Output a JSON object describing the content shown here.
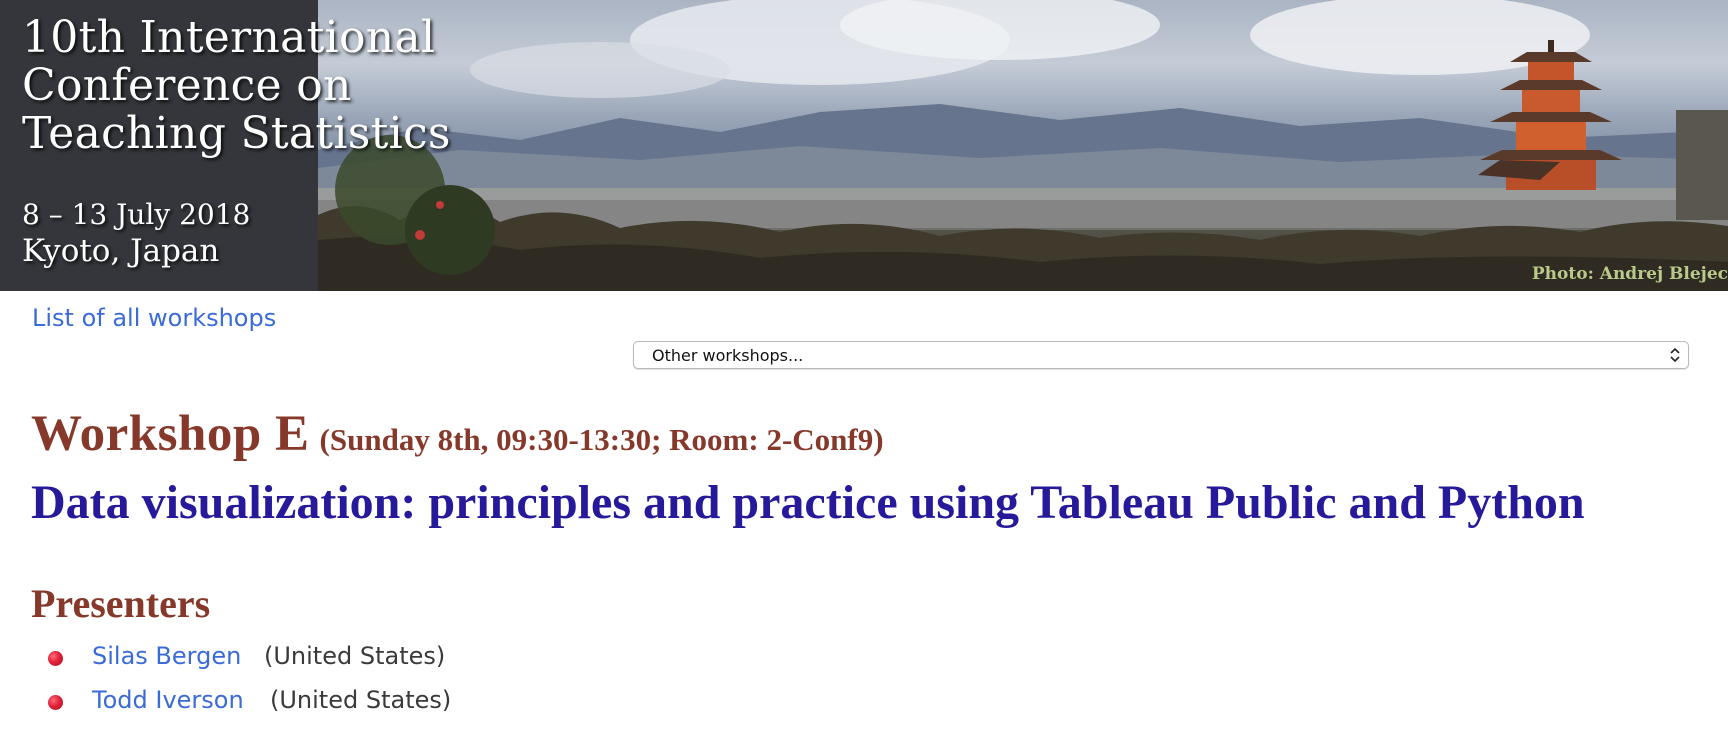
{
  "banner": {
    "title": "10th International Conference on Teaching Statistics",
    "dates": "8 – 13 July 2018",
    "location": "Kyoto, Japan",
    "photo_credit": "Photo: Andrej Blejec"
  },
  "nav": {
    "all_workshops_label": "List of all workshops",
    "select_value": "Other workshops..."
  },
  "workshop": {
    "name": "Workshop E",
    "time": "(Sunday 8th, 09:30-13:30; Room: 2-Conf9)",
    "title": "Data visualization: principles and practice using Tableau Public and Python"
  },
  "presenters": {
    "heading": "Presenters",
    "items": [
      {
        "name": "Silas Bergen",
        "country": "(United States)"
      },
      {
        "name": "Todd Iverson",
        "country": "(United States)"
      }
    ]
  },
  "colors": {
    "link": "#3a6bd6",
    "heading_brown": "#86392a",
    "title_indigo": "#261a9b",
    "bullet_red": "#e0213a",
    "banner_panel": "#34363b"
  },
  "icons": {
    "select_arrows": "chevron-up-down-icon",
    "bullet": "red-dot-bullet"
  }
}
